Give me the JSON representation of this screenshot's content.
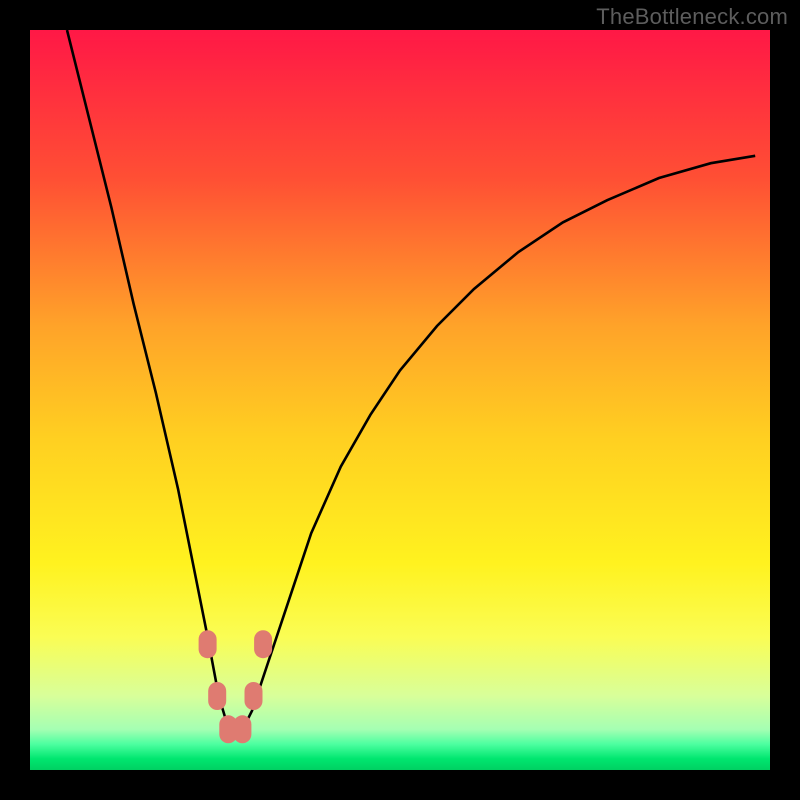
{
  "watermark": "TheBottleneck.com",
  "gradient_stops": [
    {
      "offset": 0.0,
      "color": "#ff1846"
    },
    {
      "offset": 0.2,
      "color": "#ff4f34"
    },
    {
      "offset": 0.4,
      "color": "#ffa329"
    },
    {
      "offset": 0.55,
      "color": "#ffcf21"
    },
    {
      "offset": 0.72,
      "color": "#fff21f"
    },
    {
      "offset": 0.82,
      "color": "#fafd54"
    },
    {
      "offset": 0.9,
      "color": "#d8ff9a"
    },
    {
      "offset": 0.945,
      "color": "#a5ffb3"
    },
    {
      "offset": 0.965,
      "color": "#4dffa0"
    },
    {
      "offset": 0.985,
      "color": "#00e66f"
    },
    {
      "offset": 1.0,
      "color": "#00d062"
    }
  ],
  "chart_data": {
    "type": "line",
    "title": "",
    "xlabel": "",
    "ylabel": "",
    "xlim": [
      0,
      100
    ],
    "ylim": [
      0,
      100
    ],
    "series": [
      {
        "name": "bottleneck-curve",
        "note": "V-shaped curve; values are estimated from pixel positions. y: 0=bottom (good/green), 100=top (bad/red). Minimum ≈ x 26–29 at y≈5.",
        "x": [
          5,
          8,
          11,
          14,
          17,
          20,
          22,
          24,
          25.5,
          27,
          28.5,
          30,
          32,
          35,
          38,
          42,
          46,
          50,
          55,
          60,
          66,
          72,
          78,
          85,
          92,
          98
        ],
        "y": [
          100,
          88,
          76,
          63,
          51,
          38,
          28,
          18,
          10,
          5,
          5,
          8,
          14,
          23,
          32,
          41,
          48,
          54,
          60,
          65,
          70,
          74,
          77,
          80,
          82,
          83
        ]
      }
    ],
    "markers": [
      {
        "name": "marker-left-upper",
        "x": 24.0,
        "y": 17,
        "color": "#df7b71"
      },
      {
        "name": "marker-left-lower",
        "x": 25.3,
        "y": 10,
        "color": "#df7b71"
      },
      {
        "name": "marker-bottom-left",
        "x": 26.8,
        "y": 5.5,
        "color": "#df7b71"
      },
      {
        "name": "marker-bottom-right",
        "x": 28.7,
        "y": 5.5,
        "color": "#df7b71"
      },
      {
        "name": "marker-right-lower",
        "x": 30.2,
        "y": 10,
        "color": "#df7b71"
      },
      {
        "name": "marker-right-upper",
        "x": 31.5,
        "y": 17,
        "color": "#df7b71"
      }
    ]
  }
}
